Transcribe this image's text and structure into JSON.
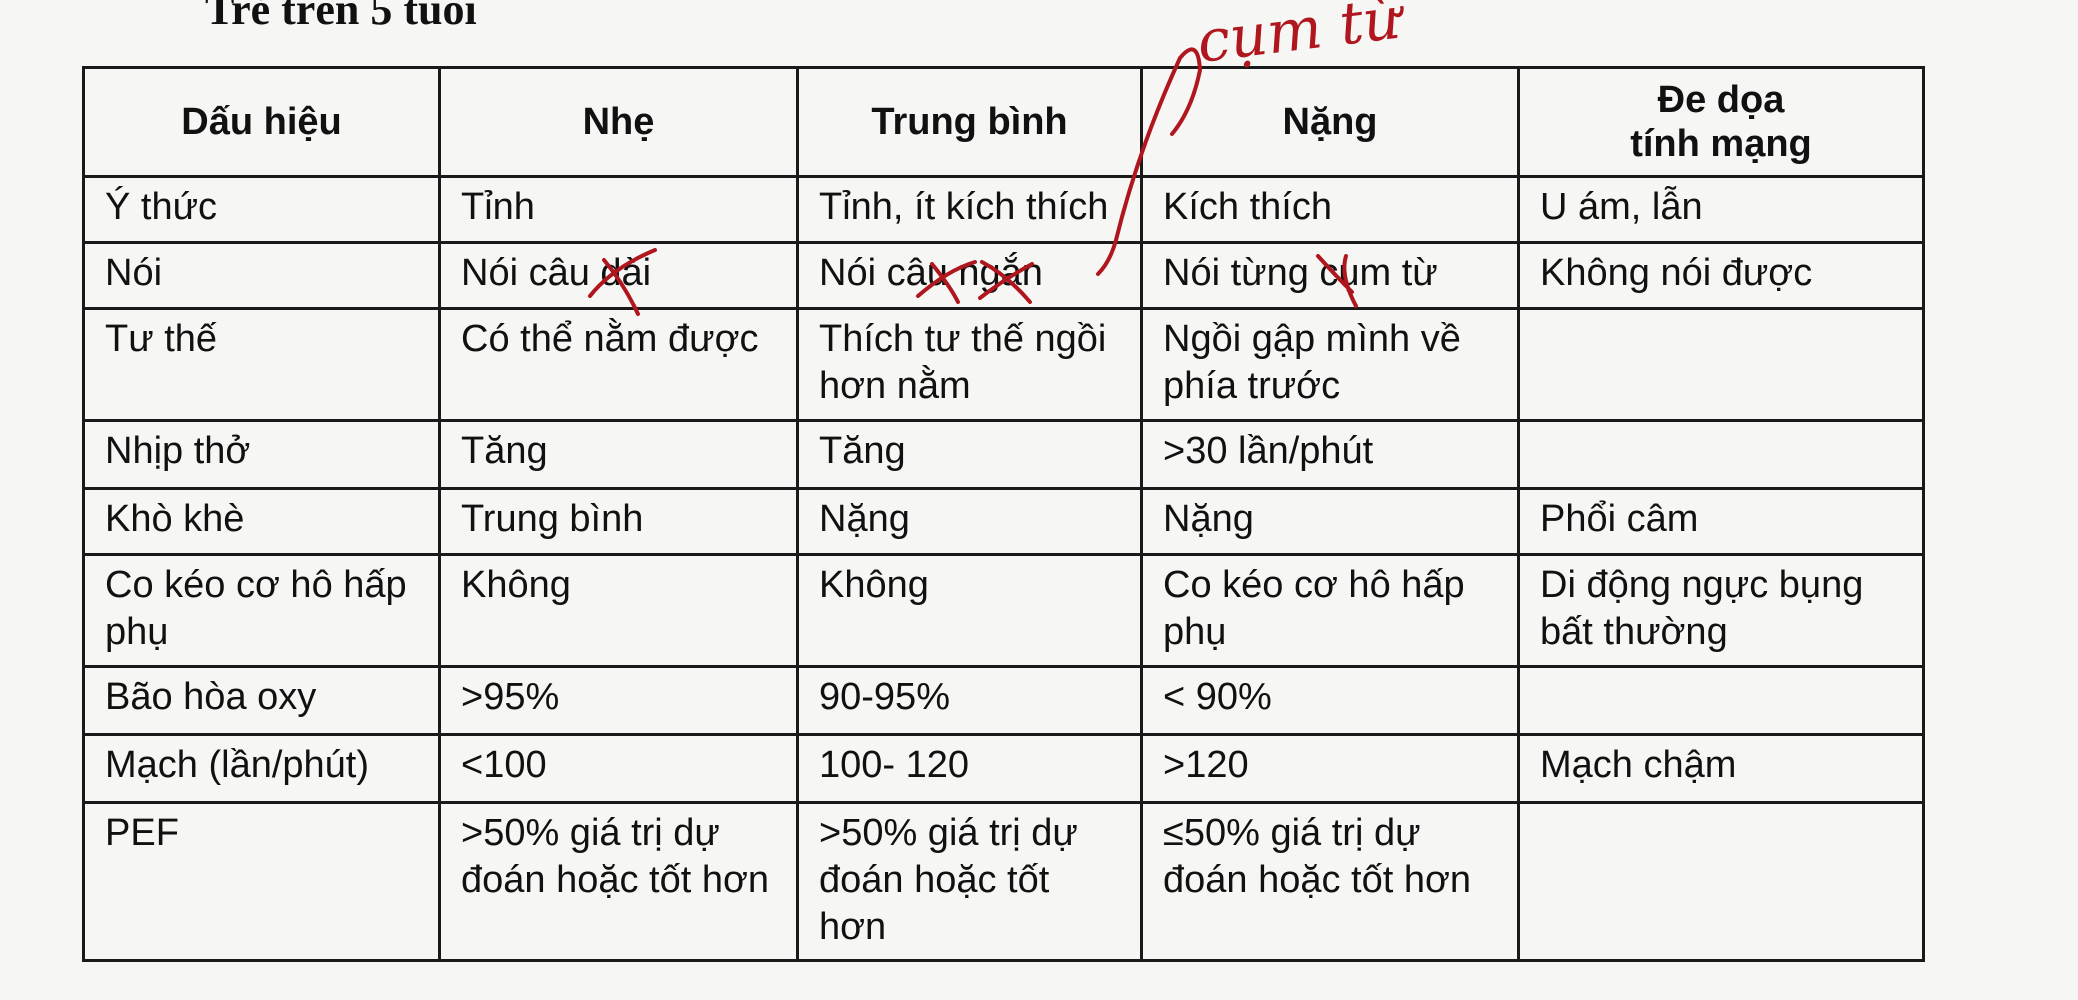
{
  "document": {
    "title": "Trẻ trên 5 tuổi"
  },
  "table": {
    "headers": [
      "Dấu hiệu",
      "Nhẹ",
      "Trung bình",
      "Nặng",
      "Đe dọa\ntính mạng"
    ],
    "rows": [
      [
        "Ý thức",
        "Tỉnh",
        "Tỉnh, ít kích thích",
        "Kích thích",
        "U ám, lẫn"
      ],
      [
        "Nói",
        "Nói câu dài",
        "Nói câu ngắn",
        "Nói từng cụm từ",
        "Không nói được"
      ],
      [
        "Tư thế",
        "Có thể nằm được",
        "Thích tư thế ngồi hơn nằm",
        "Ngồi gập mình về phía trước",
        ""
      ],
      [
        "Nhịp thở",
        "Tăng",
        "Tăng",
        ">30 lần/phút",
        ""
      ],
      [
        "Khò khè",
        "Trung bình",
        "Nặng",
        "Nặng",
        "Phổi câm"
      ],
      [
        "Co kéo cơ hô hấp phụ",
        "Không",
        "Không",
        "Co kéo cơ hô hấp phụ",
        "Di động ngực bụng bất thường"
      ],
      [
        "Bão hòa oxy",
        ">95%",
        "90-95%",
        "< 90%",
        ""
      ],
      [
        "Mạch (lần/phút)",
        "<100",
        "100- 120",
        ">120",
        "Mạch chậm"
      ],
      [
        "PEF",
        ">50% giá trị dự đoán hoặc tốt hơn",
        ">50% giá trị dự đoán hoặc tốt hơn",
        "≤50% giá trị dự đoán hoặc tốt hơn",
        ""
      ]
    ]
  },
  "annotations": {
    "handwritten_note": "cụm từ",
    "ink_color": "#b0161e"
  }
}
